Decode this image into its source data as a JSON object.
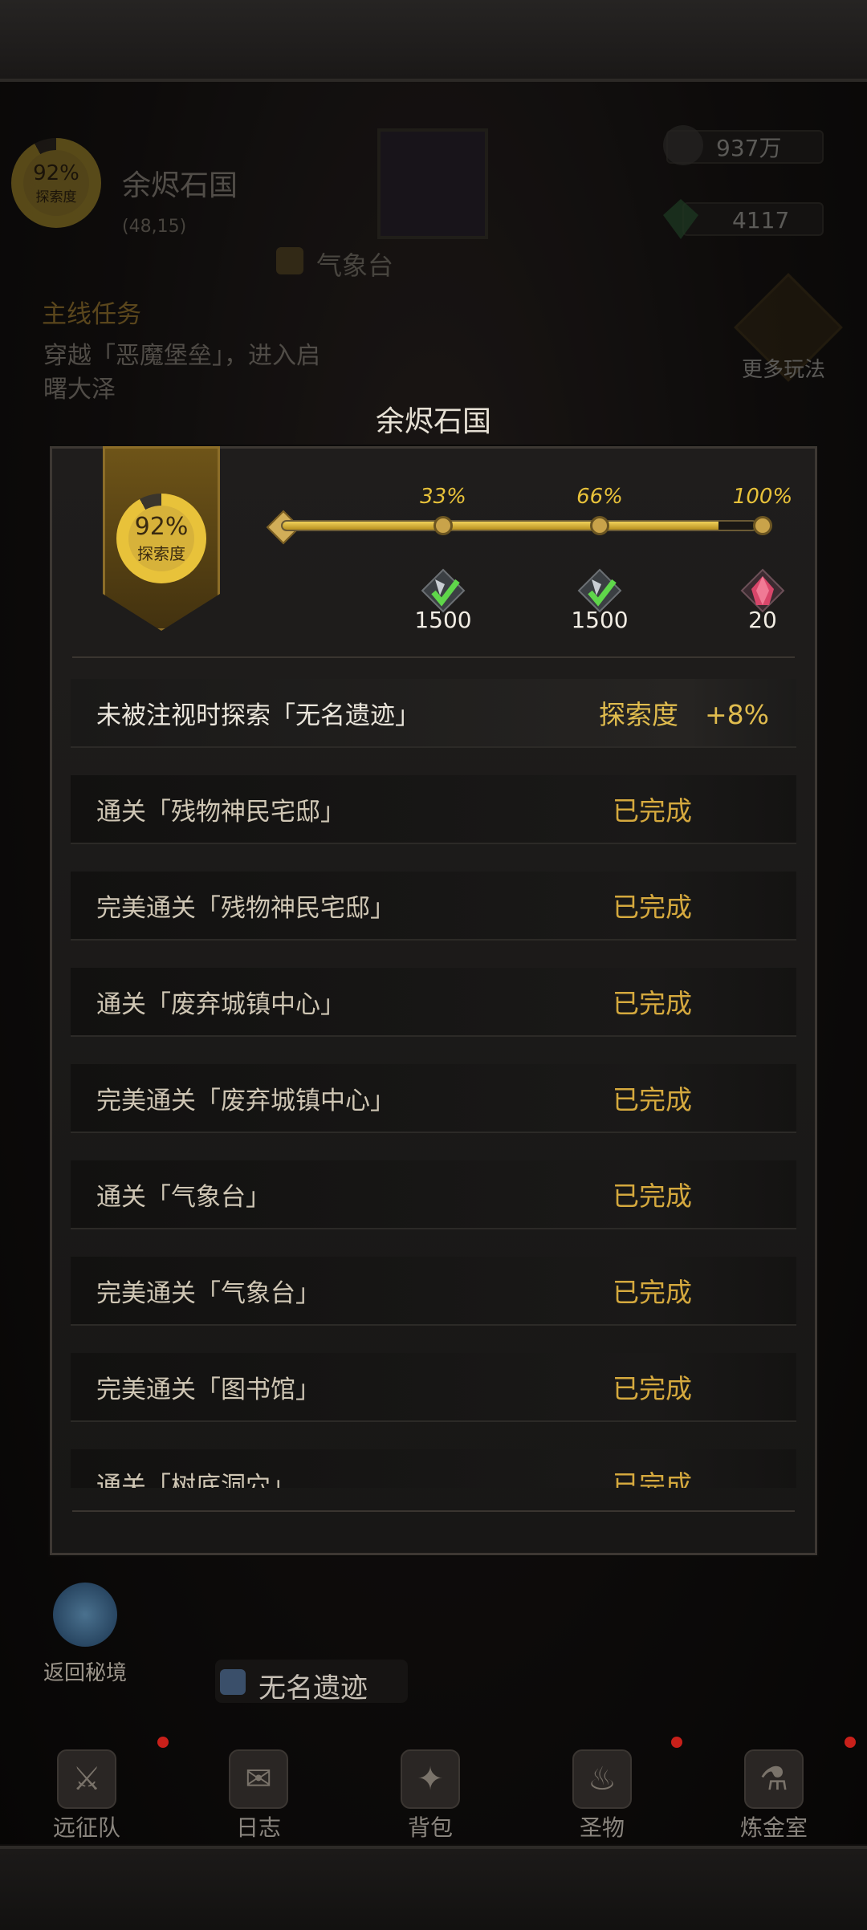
{
  "hud": {
    "zone_gauge_percent": "92%",
    "zone_gauge_label": "探索度",
    "zone_name": "余烬石国",
    "zone_coords": "(48,15)",
    "current_location": "气象台",
    "resource_1": "937万",
    "resource_2": "4117",
    "quest_header": "主线任务",
    "quest_text_line1": "穿越「恶魔堡垒」，进入启",
    "quest_text_line2": "曙大泽",
    "more_play_label": "更多玩法",
    "return_label": "返回秘境",
    "bottom_location": "无名遗迹"
  },
  "modal": {
    "title": "余烬石国",
    "gauge_percent": "92%",
    "gauge_label": "探索度",
    "progress": 0.92,
    "milestones": [
      {
        "percent": "33%",
        "reward": "1500",
        "claimed": true
      },
      {
        "percent": "66%",
        "reward": "1500",
        "claimed": true
      },
      {
        "percent": "100%",
        "reward": "20",
        "claimed": false
      }
    ],
    "tasks": [
      {
        "label": "未被注视时探索「无名遗迹」",
        "status": "探索度　+8%"
      },
      {
        "label": "通关「残物神民宅邸」",
        "status": "已完成"
      },
      {
        "label": "完美通关「残物神民宅邸」",
        "status": "已完成"
      },
      {
        "label": "通关「废弃城镇中心」",
        "status": "已完成"
      },
      {
        "label": "完美通关「废弃城镇中心」",
        "status": "已完成"
      },
      {
        "label": "通关「气象台」",
        "status": "已完成"
      },
      {
        "label": "完美通关「气象台」",
        "status": "已完成"
      },
      {
        "label": "完美通关「图书馆」",
        "status": "已完成"
      },
      {
        "label": "通关「树底洞穴」",
        "status": "已完成"
      }
    ]
  },
  "nav": [
    {
      "label": "远征队",
      "icon": "helmet-icon"
    },
    {
      "label": "日志",
      "icon": "map-scroll-icon"
    },
    {
      "label": "背包",
      "icon": "backpack-icon"
    },
    {
      "label": "圣物",
      "icon": "torch-icon"
    },
    {
      "label": "炼金室",
      "icon": "alchemy-icon"
    }
  ],
  "colors": {
    "accent_gold": "#e8c23a",
    "status_gold": "#d5a93e",
    "notification_red": "#c8201a"
  }
}
